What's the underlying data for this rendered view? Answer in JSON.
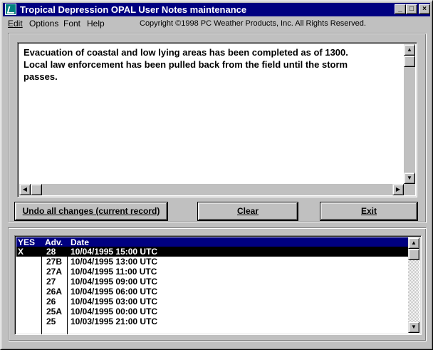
{
  "window": {
    "title": "Tropical Depression OPAL User Notes maintenance",
    "controls": {
      "minimize": "_",
      "maximize": "□",
      "close": "×"
    }
  },
  "menu": {
    "items": [
      {
        "label": "Edit",
        "mnemonic": "E"
      },
      {
        "label": "Options",
        "mnemonic": "O"
      },
      {
        "label": "Font",
        "mnemonic": "F"
      },
      {
        "label": "Help",
        "mnemonic": "H"
      }
    ],
    "copyright": "Copyright ©1998 PC Weather Products, Inc. All Rights Reserved."
  },
  "notes": {
    "text": "Evacuation of coastal and low lying areas has been completed as of 1300.\nLocal law enforcement has been pulled back from the field until the storm\npasses."
  },
  "buttons": {
    "undo": "Undo all changes (current record)",
    "clear": "Clear",
    "exit": "Exit"
  },
  "icons": {
    "app": "weather-app-icon",
    "scroll_up": "▲",
    "scroll_down": "▼",
    "scroll_left": "◀",
    "scroll_right": "▶"
  },
  "list": {
    "columns": [
      "YES",
      "Adv.",
      "Date"
    ],
    "rows": [
      {
        "yes": "X",
        "adv": "28",
        "date": "10/04/1995 15:00 UTC",
        "selected": true
      },
      {
        "yes": "",
        "adv": "27B",
        "date": "10/04/1995 13:00 UTC",
        "selected": false
      },
      {
        "yes": "",
        "adv": "27A",
        "date": "10/04/1995 11:00 UTC",
        "selected": false
      },
      {
        "yes": "",
        "adv": "27",
        "date": "10/04/1995 09:00 UTC",
        "selected": false
      },
      {
        "yes": "",
        "adv": "26A",
        "date": "10/04/1995 06:00 UTC",
        "selected": false
      },
      {
        "yes": "",
        "adv": "26",
        "date": "10/04/1995 03:00 UTC",
        "selected": false
      },
      {
        "yes": "",
        "adv": "25A",
        "date": "10/04/1995 00:00 UTC",
        "selected": false
      },
      {
        "yes": "",
        "adv": "25",
        "date": "10/03/1995 21:00 UTC",
        "selected": false
      }
    ]
  },
  "colors": {
    "titlebar": "#000080",
    "face": "#c0c0c0",
    "selection": "#000000"
  }
}
